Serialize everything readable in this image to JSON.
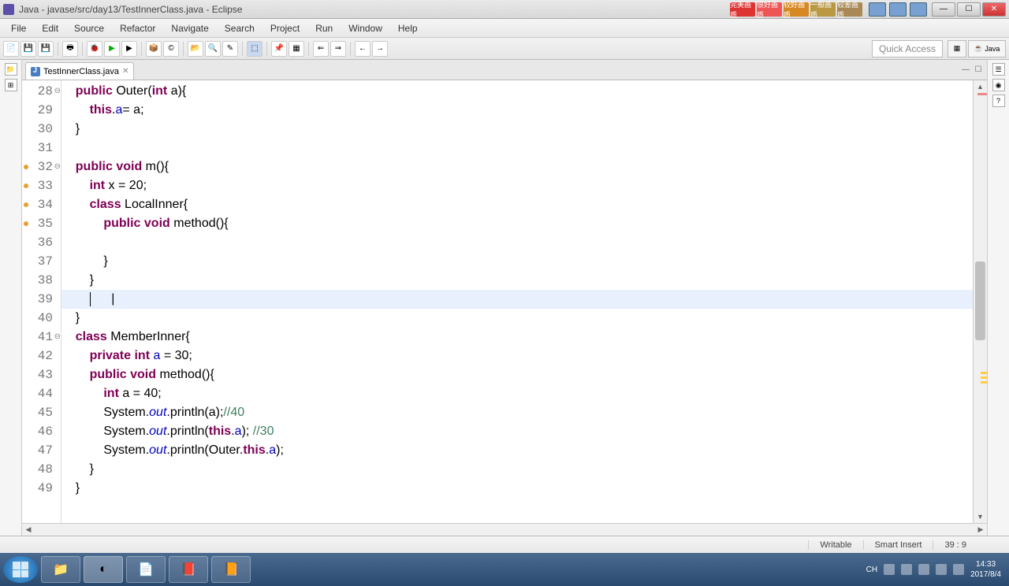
{
  "window": {
    "title": "Java - javase/src/day13/TestInnerClass.java - Eclipse"
  },
  "quality_badges": [
    "完美画质",
    "很好画质",
    "较好画质",
    "一般画质",
    "较差画质"
  ],
  "menu": [
    "File",
    "Edit",
    "Source",
    "Refactor",
    "Navigate",
    "Search",
    "Project",
    "Run",
    "Window",
    "Help"
  ],
  "quick_access": {
    "placeholder": "Quick Access"
  },
  "perspective": {
    "label": "Java"
  },
  "tab": {
    "name": "TestInnerClass.java",
    "close": "✕"
  },
  "gutter": {
    "start": 28,
    "lines": [
      {
        "n": 28,
        "folded": true
      },
      {
        "n": 29
      },
      {
        "n": 30
      },
      {
        "n": 31
      },
      {
        "n": 32,
        "marked": true,
        "folded": true
      },
      {
        "n": 33,
        "marked": true
      },
      {
        "n": 34,
        "marked": true
      },
      {
        "n": 35,
        "marked": true
      },
      {
        "n": 36
      },
      {
        "n": 37
      },
      {
        "n": 38
      },
      {
        "n": 39
      },
      {
        "n": 40
      },
      {
        "n": 41,
        "folded": true
      },
      {
        "n": 42
      },
      {
        "n": 43
      },
      {
        "n": 44
      },
      {
        "n": 45
      },
      {
        "n": 46
      },
      {
        "n": 47
      },
      {
        "n": 48
      },
      {
        "n": 49
      }
    ]
  },
  "code": [
    {
      "indent": "    ",
      "tokens": [
        {
          "t": "public",
          "c": "kw"
        },
        {
          "t": " Outer("
        },
        {
          "t": "int",
          "c": "kw"
        },
        {
          "t": " a){"
        }
      ]
    },
    {
      "indent": "        ",
      "tokens": [
        {
          "t": "this",
          "c": "kw"
        },
        {
          "t": "."
        },
        {
          "t": "a",
          "c": "fld"
        },
        {
          "t": "= a;"
        }
      ]
    },
    {
      "indent": "    ",
      "tokens": [
        {
          "t": "}"
        }
      ]
    },
    {
      "indent": "",
      "tokens": []
    },
    {
      "indent": "    ",
      "tokens": [
        {
          "t": "public",
          "c": "kw"
        },
        {
          "t": " "
        },
        {
          "t": "void",
          "c": "kw"
        },
        {
          "t": " m(){"
        }
      ]
    },
    {
      "indent": "        ",
      "tokens": [
        {
          "t": "int",
          "c": "kw"
        },
        {
          "t": " x = 20;"
        }
      ]
    },
    {
      "indent": "        ",
      "tokens": [
        {
          "t": "class",
          "c": "kw"
        },
        {
          "t": " LocalInner{"
        }
      ]
    },
    {
      "indent": "            ",
      "tokens": [
        {
          "t": "public",
          "c": "kw"
        },
        {
          "t": " "
        },
        {
          "t": "void",
          "c": "kw"
        },
        {
          "t": " method(){"
        }
      ]
    },
    {
      "indent": "",
      "tokens": []
    },
    {
      "indent": "            ",
      "tokens": [
        {
          "t": "}"
        }
      ]
    },
    {
      "indent": "        ",
      "tokens": [
        {
          "t": "}"
        }
      ]
    },
    {
      "indent": "        ",
      "tokens": [],
      "current": true,
      "cursor": true,
      "textcursor": "      |"
    },
    {
      "indent": "    ",
      "tokens": [
        {
          "t": "}"
        }
      ]
    },
    {
      "indent": "    ",
      "tokens": [
        {
          "t": "class",
          "c": "kw"
        },
        {
          "t": " MemberInner{"
        }
      ]
    },
    {
      "indent": "        ",
      "tokens": [
        {
          "t": "private",
          "c": "kw"
        },
        {
          "t": " "
        },
        {
          "t": "int",
          "c": "kw"
        },
        {
          "t": " "
        },
        {
          "t": "a",
          "c": "fld"
        },
        {
          "t": " = 30;"
        }
      ]
    },
    {
      "indent": "        ",
      "tokens": [
        {
          "t": "public",
          "c": "kw"
        },
        {
          "t": " "
        },
        {
          "t": "void",
          "c": "kw"
        },
        {
          "t": " method(){"
        }
      ]
    },
    {
      "indent": "            ",
      "tokens": [
        {
          "t": "int",
          "c": "kw"
        },
        {
          "t": " a = 40;"
        }
      ]
    },
    {
      "indent": "            ",
      "tokens": [
        {
          "t": "System."
        },
        {
          "t": "out",
          "c": "fld-i"
        },
        {
          "t": ".println(a);"
        },
        {
          "t": "//40",
          "c": "cm"
        }
      ]
    },
    {
      "indent": "            ",
      "tokens": [
        {
          "t": "System."
        },
        {
          "t": "out",
          "c": "fld-i"
        },
        {
          "t": ".println("
        },
        {
          "t": "this",
          "c": "kw"
        },
        {
          "t": "."
        },
        {
          "t": "a",
          "c": "fld"
        },
        {
          "t": "); "
        },
        {
          "t": "//30",
          "c": "cm"
        }
      ]
    },
    {
      "indent": "            ",
      "tokens": [
        {
          "t": "System."
        },
        {
          "t": "out",
          "c": "fld-i"
        },
        {
          "t": ".println(Outer."
        },
        {
          "t": "this",
          "c": "kw"
        },
        {
          "t": "."
        },
        {
          "t": "a",
          "c": "fld"
        },
        {
          "t": ");"
        }
      ]
    },
    {
      "indent": "        ",
      "tokens": [
        {
          "t": "}"
        }
      ]
    },
    {
      "indent": "    ",
      "tokens": [
        {
          "t": "}"
        }
      ]
    }
  ],
  "status": {
    "writable": "Writable",
    "insert": "Smart Insert",
    "pos": "39 : 9"
  },
  "tray": {
    "ime": "CH",
    "time": "14:33",
    "date": "2017/8/4"
  }
}
